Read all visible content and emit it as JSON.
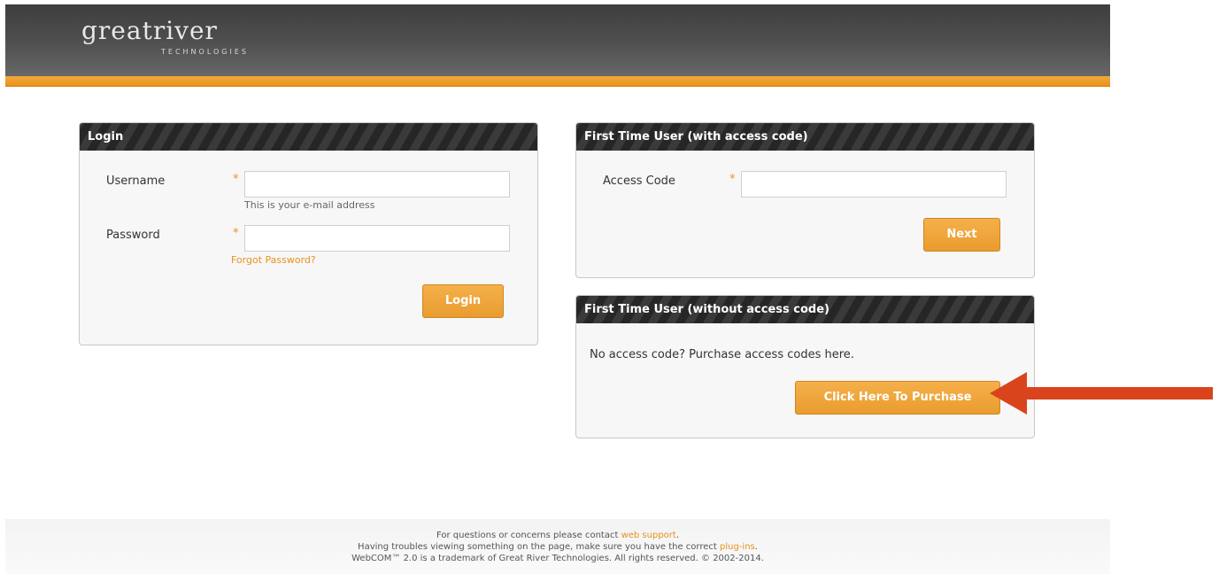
{
  "header": {
    "logo_main": "greatriver",
    "logo_sub": "TECHNOLOGIES"
  },
  "login_panel": {
    "title": "Login",
    "username_label": "Username",
    "username_required": "*",
    "username_value": "",
    "username_hint": "This is your e-mail address",
    "password_label": "Password",
    "password_required": "*",
    "password_value": "",
    "forgot_link": "Forgot Password?",
    "login_button": "Login"
  },
  "access_code_panel": {
    "title": "First Time User (with access code)",
    "access_code_label": "Access Code",
    "access_code_required": "*",
    "access_code_value": "",
    "next_button": "Next"
  },
  "purchase_panel": {
    "title": "First Time User (without access code)",
    "message": "No access code? Purchase access codes here.",
    "purchase_button": "Click Here To Purchase"
  },
  "footer": {
    "line1_prefix": "For questions or concerns please contact ",
    "line1_link": "web support",
    "line1_suffix": ".",
    "line2_prefix": "Having troubles viewing something on the page, make sure you have the correct ",
    "line2_link": "plug-ins",
    "line2_suffix": ".",
    "line3": "WebCOM™ 2.0 is a trademark of Great River Technologies. All rights reserved. © 2002-2014."
  },
  "colors": {
    "accent": "#e8921c",
    "annotation_arrow": "#d9441c",
    "panel_header": "#2c2c2c"
  }
}
